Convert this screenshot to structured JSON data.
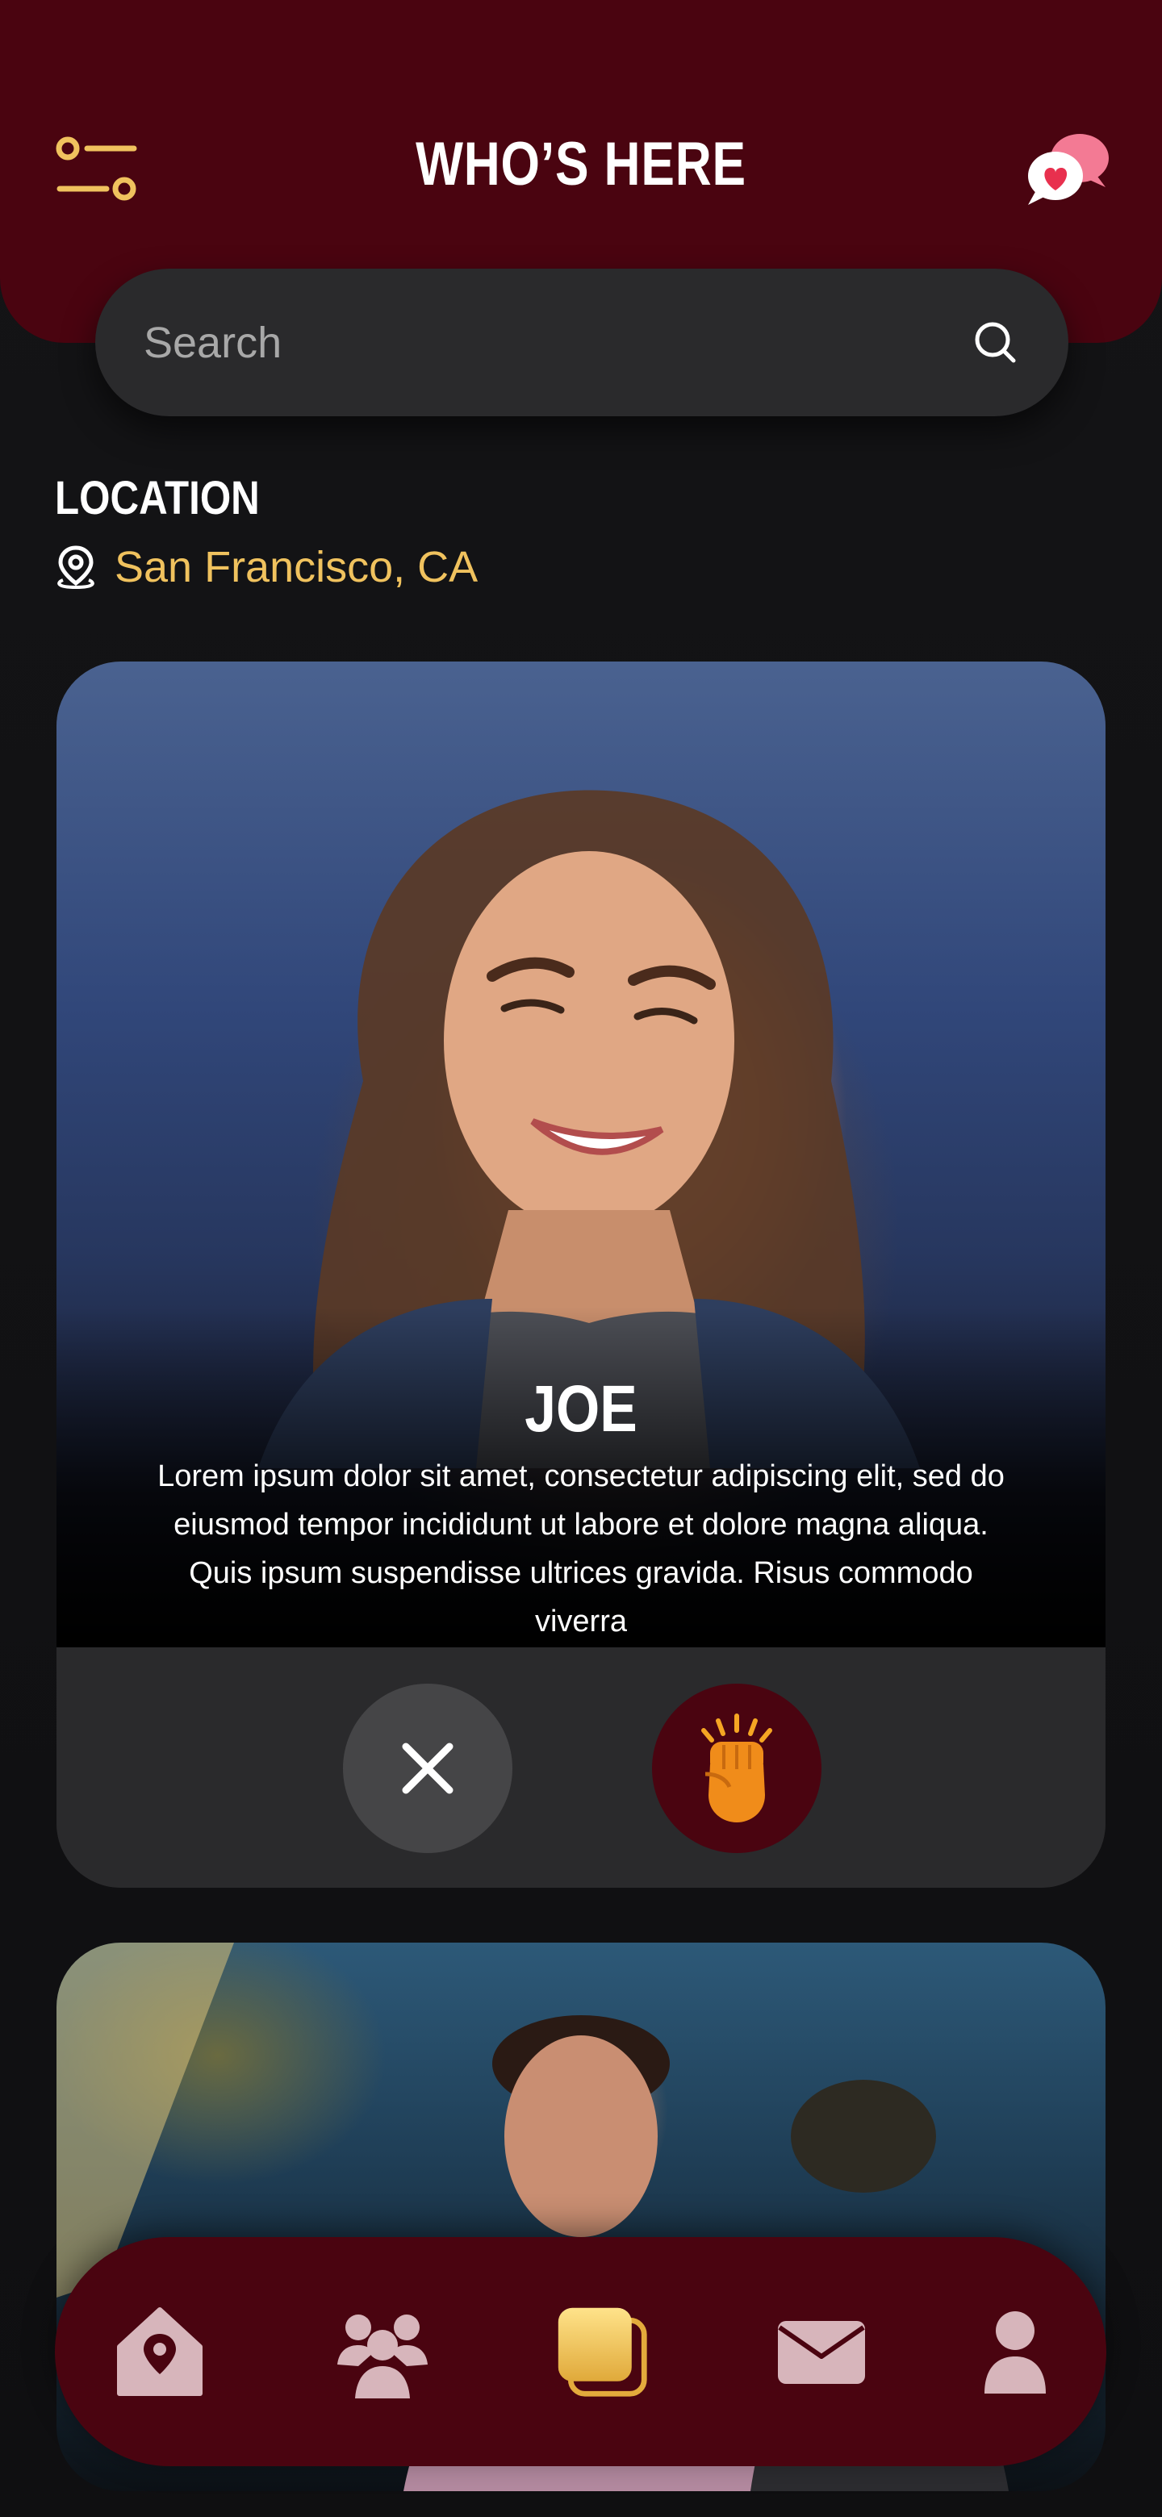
{
  "header": {
    "title": "WHO’S HERE"
  },
  "search": {
    "placeholder": "Search"
  },
  "location": {
    "label": "LOCATION",
    "value": "San Francisco, CA"
  },
  "cards": [
    {
      "name": "JOE",
      "description": "Lorem ipsum dolor sit amet, consectetur adipiscing elit, sed do eiusmod tempor incididunt ut labore et dolore magna aliqua. Quis ipsum suspendisse ultrices gravida. Risus commodo viverra"
    }
  ],
  "nav": {
    "items": [
      {
        "icon": "home-location-icon",
        "active": false
      },
      {
        "icon": "people-icon",
        "active": false
      },
      {
        "icon": "cards-icon",
        "active": true
      },
      {
        "icon": "mail-icon",
        "active": false
      },
      {
        "icon": "profile-icon",
        "active": false
      }
    ]
  },
  "colors": {
    "brand": "#4a0410",
    "accent": "#f0c25e",
    "background": "#141416",
    "surface": "#2a2a2c"
  }
}
